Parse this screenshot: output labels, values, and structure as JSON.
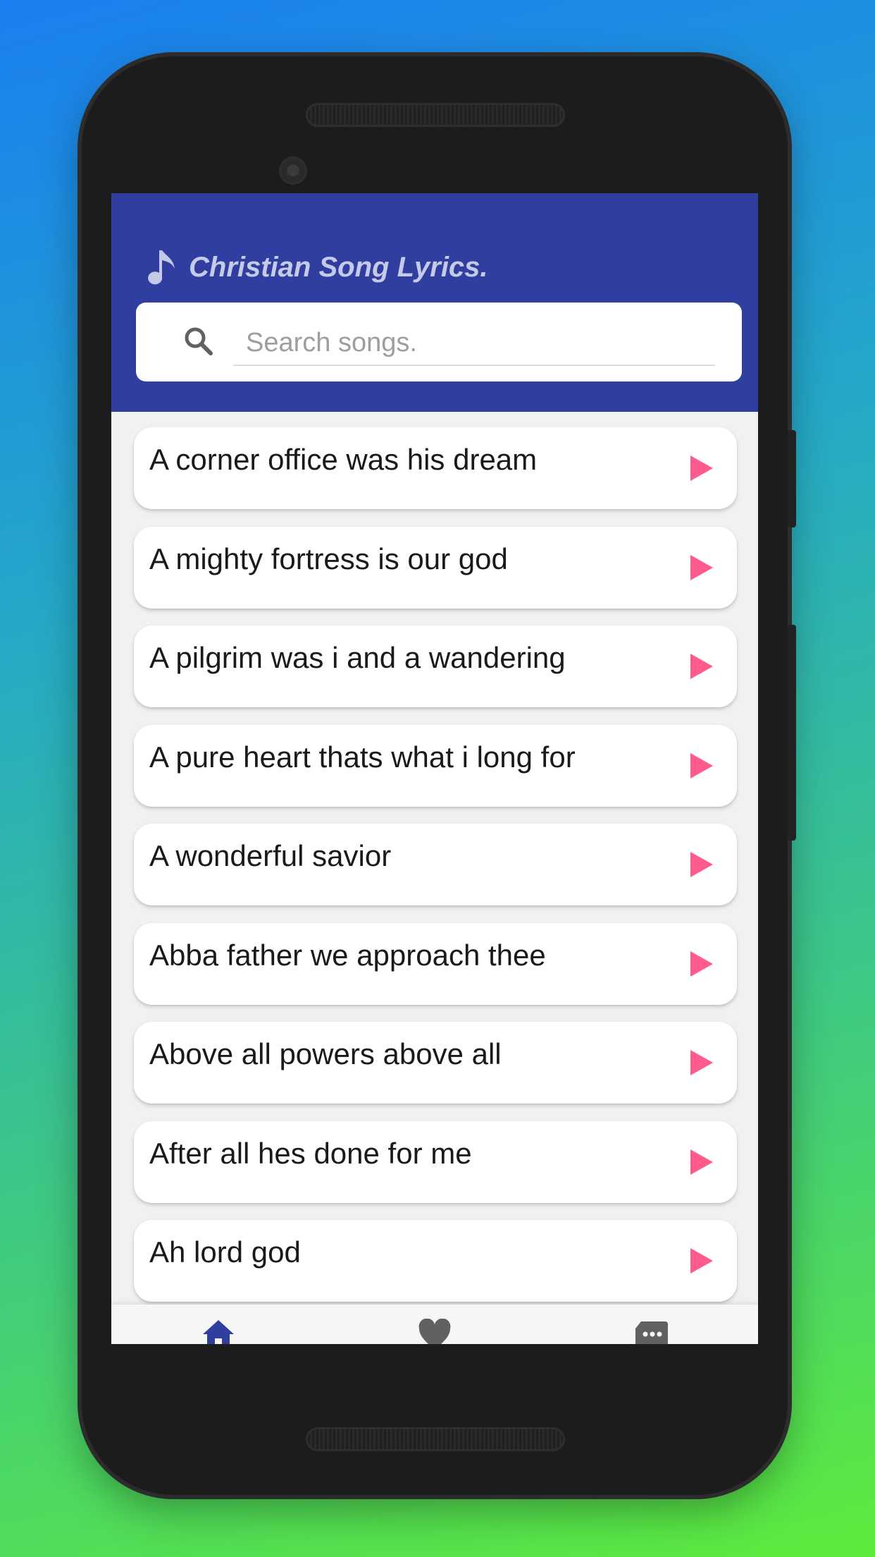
{
  "app": {
    "title": "Christian Song Lyrics.",
    "accent_color": "#303f9f",
    "play_color": "#ff5c8d"
  },
  "search": {
    "placeholder": "Search songs.",
    "value": ""
  },
  "songs": [
    "A corner office was his dream",
    "A mighty fortress is our god",
    "A pilgrim was i and a wandering",
    "A pure heart thats what i long for",
    "A wonderful savior",
    "Abba father we approach thee",
    "Above all powers above all",
    "After all hes done for me",
    "Ah lord god"
  ],
  "bottom_nav": {
    "items": [
      {
        "icon": "home-icon",
        "active": true
      },
      {
        "icon": "heart-icon",
        "active": false
      },
      {
        "icon": "message-icon",
        "active": false
      }
    ]
  }
}
